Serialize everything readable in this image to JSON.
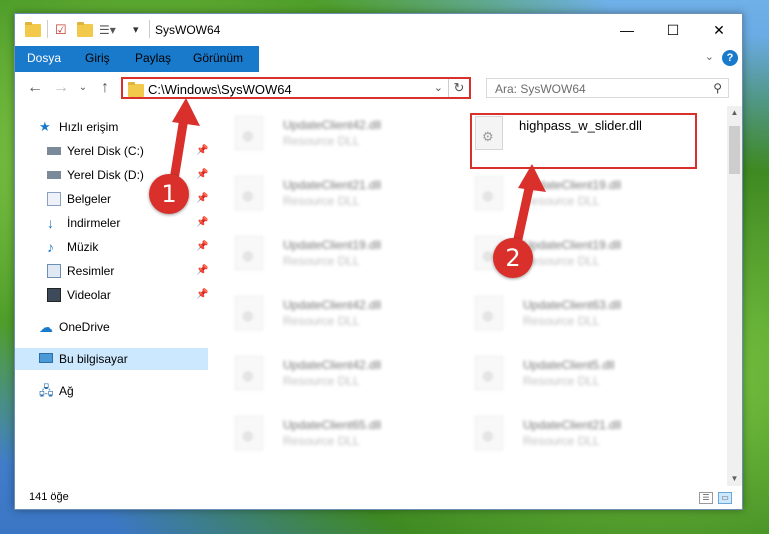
{
  "window": {
    "title": "SysWOW64",
    "minimize": "—",
    "maximize": "☐",
    "close": "✕"
  },
  "ribbon": {
    "tabs": [
      {
        "label": "Dosya"
      },
      {
        "label": "Giriş"
      },
      {
        "label": "Paylaş"
      },
      {
        "label": "Görünüm"
      }
    ],
    "help": "?"
  },
  "address": {
    "path": "C:\\Windows\\SysWOW64",
    "search_placeholder": "Ara: SysWOW64"
  },
  "nav": {
    "items": [
      {
        "label": "Hızlı erişim",
        "icon": "star-icon"
      },
      {
        "label": "Yerel Disk (C:)",
        "icon": "drive-icon",
        "pinned": true
      },
      {
        "label": "Yerel Disk (D:)",
        "icon": "drive-icon",
        "pinned": true
      },
      {
        "label": "Belgeler",
        "icon": "documents-icon",
        "pinned": true
      },
      {
        "label": "İndirmeler",
        "icon": "download-icon",
        "pinned": true
      },
      {
        "label": "Müzik",
        "icon": "music-icon",
        "pinned": true
      },
      {
        "label": "Resimler",
        "icon": "pictures-icon",
        "pinned": true
      },
      {
        "label": "Videolar",
        "icon": "video-icon",
        "pinned": true
      },
      {
        "label": "OneDrive",
        "icon": "cloud-icon"
      },
      {
        "label": "Bu bilgisayar",
        "icon": "computer-icon",
        "selected": true
      },
      {
        "label": "Ağ",
        "icon": "network-icon"
      }
    ]
  },
  "files": {
    "highlighted": {
      "name": "highpass_w_slider.dll"
    },
    "left": [
      {
        "name": "UpdateClient42.dll",
        "desc": "Resource DLL"
      },
      {
        "name": "UpdateClient21.dll",
        "desc": "Resource DLL"
      },
      {
        "name": "UpdateClient19.dll",
        "desc": "Resource DLL"
      },
      {
        "name": "UpdateClient42.dll",
        "desc": "Resource DLL"
      },
      {
        "name": "UpdateClient42.dll",
        "desc": "Resource DLL"
      },
      {
        "name": "UpdateClient65.dll",
        "desc": "Resource DLL"
      }
    ],
    "right": [
      {
        "name": "UpdateClient19.dll",
        "desc": "Resource DLL"
      },
      {
        "name": "UpdateClient19.dll",
        "desc": "Resource DLL"
      },
      {
        "name": "UpdateClient63.dll",
        "desc": "Resource DLL"
      },
      {
        "name": "UpdateClient5.dll",
        "desc": "Resource DLL"
      },
      {
        "name": "UpdateClient21.dll",
        "desc": "Resource DLL"
      }
    ]
  },
  "status": {
    "count": "141 öğe"
  },
  "callouts": {
    "one": "1",
    "two": "2"
  },
  "colors": {
    "accent": "#1979ca",
    "highlight": "#d9302b"
  }
}
